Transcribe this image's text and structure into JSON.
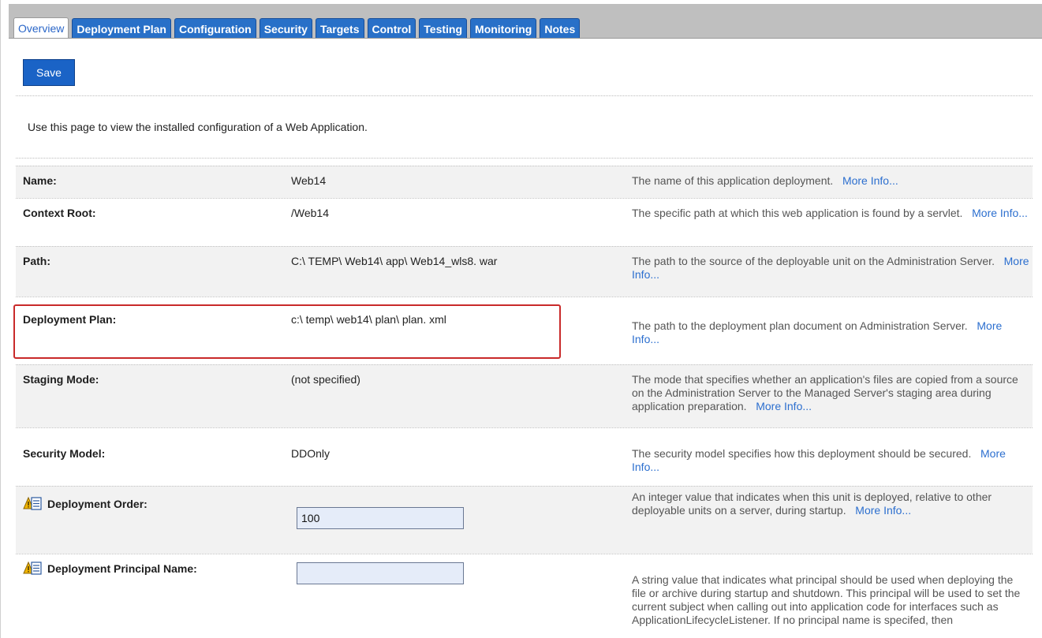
{
  "tabs": [
    {
      "label": "Overview",
      "active": true
    },
    {
      "label": "Deployment Plan",
      "active": false
    },
    {
      "label": "Configuration",
      "active": false
    },
    {
      "label": "Security",
      "active": false
    },
    {
      "label": "Targets",
      "active": false
    },
    {
      "label": "Control",
      "active": false
    },
    {
      "label": "Testing",
      "active": false
    },
    {
      "label": "Monitoring",
      "active": false
    },
    {
      "label": "Notes",
      "active": false
    }
  ],
  "toolbar": {
    "save_label": "Save"
  },
  "intro": "Use this page to view the installed configuration of a Web Application.",
  "more_info_label": "More Info...",
  "fields": [
    {
      "label": "Name:",
      "value": "Web14",
      "description": "The name of this application deployment."
    },
    {
      "label": "Context Root:",
      "value": "/Web14",
      "description": "The specific path at which this web application is found by a servlet."
    },
    {
      "label": "Path:",
      "value": "C:\\ TEMP\\ Web14\\ app\\ Web14_wls8. war",
      "description": "The path to the source of the deployable unit on the Administration Server."
    },
    {
      "label": "Deployment Plan:",
      "value": "c:\\ temp\\ web14\\ plan\\ plan. xml",
      "description": "The path to the deployment plan document on Administration Server."
    },
    {
      "label": "Staging Mode:",
      "value": "(not specified)",
      "description": "The mode that specifies whether an application's files are copied from a source on the Administration Server to the Managed Server's staging area during application preparation."
    },
    {
      "label": "Security Model:",
      "value": "DDOnly",
      "description": "The security model specifies how this deployment should be secured."
    },
    {
      "label": "Deployment Order:",
      "value": "100",
      "description": "An integer value that indicates when this unit is deployed, relative to other deployable units on a server, during startup."
    },
    {
      "label": "Deployment Principal Name:",
      "value": "",
      "description": "A string value that indicates what principal should be used when deploying the file or archive during startup and shutdown. This principal will be used to set the current subject when calling out into application code for interfaces such as ApplicationLifecycleListener. If no principal name is specifed, then"
    }
  ],
  "icons": {
    "field_warning": "restart-required-icon"
  },
  "colors": {
    "tab_active_text": "#2a66c8",
    "tab_bg": "#2870c8",
    "save_bg": "#1a63c6",
    "link": "#2c6fcf",
    "highlight_border": "#c92a2a",
    "input_bg": "#e5ecf9"
  }
}
